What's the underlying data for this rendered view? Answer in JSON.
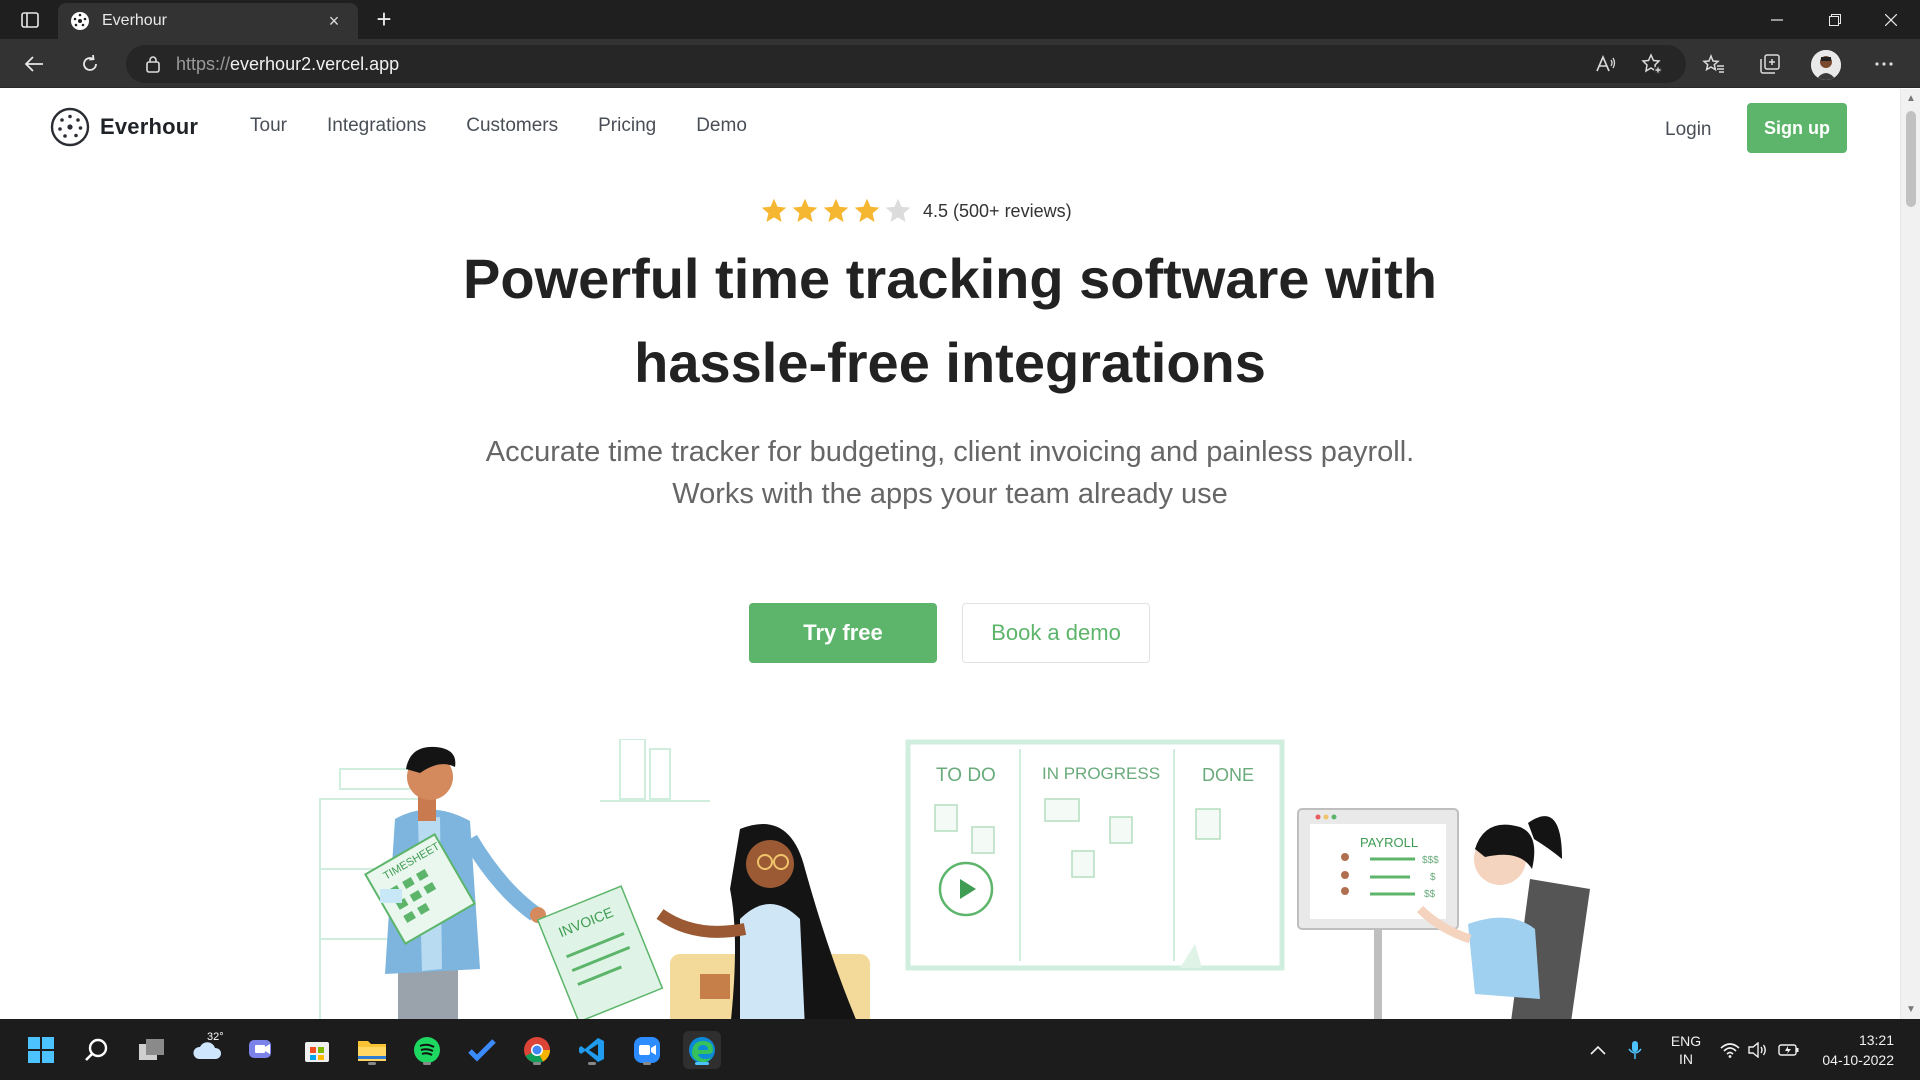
{
  "browser": {
    "tab_title": "Everhour",
    "url_proto": "https://",
    "url_host": "everhour2.vercel.app",
    "tab_close": "×",
    "new_tab": "+"
  },
  "site": {
    "brand": "Everhour",
    "nav": [
      "Tour",
      "Integrations",
      "Customers",
      "Pricing",
      "Demo"
    ],
    "login": "Login",
    "signup": "Sign up",
    "rating": {
      "stars": 4.5,
      "max": 5,
      "text": "4.5 (500+ reviews)"
    },
    "headline_line1": "Powerful time tracking software with",
    "headline_line2": "hassle-free integrations",
    "sub_line1": "Accurate time tracker for budgeting, client invoicing and painless payroll.",
    "sub_line2": "Works with the apps your team already use",
    "cta_primary": "Try free",
    "cta_secondary": "Book a demo",
    "illustration": {
      "board_cols": [
        "TO DO",
        "IN PROGRESS",
        "DONE"
      ],
      "timesheet": "TIMESHEET",
      "invoice": "INVOICE",
      "payroll": "PAYROLL",
      "money_1": "$$$",
      "money_2": "$",
      "money_3": "$$"
    }
  },
  "taskbar": {
    "weather_temp": "32°",
    "lang_1": "ENG",
    "lang_2": "IN",
    "time": "13:21",
    "date": "04-10-2022"
  },
  "colors": {
    "accent": "#5cb56a",
    "star": "#f5b731",
    "star_empty": "#dcdcdc",
    "chrome_dark": "#1f1f1f",
    "chrome_mid": "#333333"
  }
}
